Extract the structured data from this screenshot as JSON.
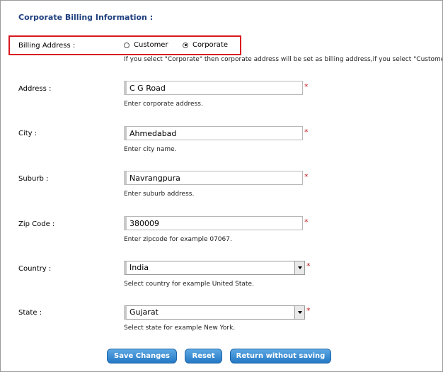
{
  "section_title": "Corporate Billing Information :",
  "billing_address": {
    "label": "Billing Address :",
    "options": [
      "Customer",
      "Corporate"
    ],
    "selected": "Corporate",
    "hint": "If you select \"Corporate\" then corporate address will be set as billing address,if you select \"Customer\" then co"
  },
  "fields": {
    "address": {
      "label": "Address :",
      "value": "C G Road",
      "hint": "Enter corporate address.",
      "required": "*"
    },
    "city": {
      "label": "City :",
      "value": "Ahmedabad",
      "hint": "Enter city name.",
      "required": "*"
    },
    "suburb": {
      "label": "Suburb :",
      "value": "Navrangpura",
      "hint": "Enter suburb address.",
      "required": "*"
    },
    "zip": {
      "label": "Zip Code :",
      "value": "380009",
      "hint": "Enter zipcode for example 07067.",
      "required": "*"
    },
    "country": {
      "label": "Country :",
      "value": "India",
      "hint": "Select country for example United State.",
      "required": "*"
    },
    "state": {
      "label": "State :",
      "value": "Gujarat",
      "hint": "Select state for example New York.",
      "required": "*"
    }
  },
  "buttons": {
    "save": "Save Changes",
    "reset": "Reset",
    "return": "Return without saving"
  },
  "colors": {
    "title": "#1f3f7f",
    "highlight": "#d9181f",
    "required": "#c0141b",
    "button": "#2378c4"
  }
}
